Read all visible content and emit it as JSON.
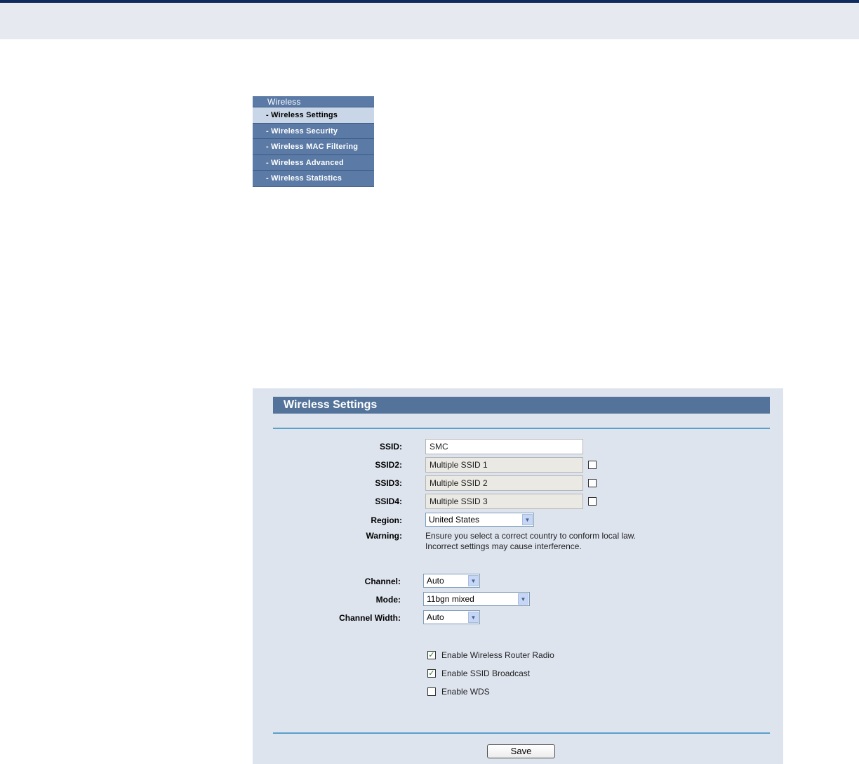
{
  "menu": {
    "header": "Wireless",
    "items": [
      {
        "label": "- Wireless Settings",
        "active": true
      },
      {
        "label": "- Wireless Security",
        "active": false
      },
      {
        "label": "- Wireless MAC Filtering",
        "active": false
      },
      {
        "label": "- Wireless Advanced",
        "active": false
      },
      {
        "label": "- Wireless Statistics",
        "active": false
      }
    ]
  },
  "panel": {
    "title": "Wireless Settings",
    "ssid": {
      "label": "SSID:",
      "value": "SMC"
    },
    "ssid2": {
      "label": "SSID2:",
      "value": "Multiple SSID 1",
      "checked": false
    },
    "ssid3": {
      "label": "SSID3:",
      "value": "Multiple SSID 2",
      "checked": false
    },
    "ssid4": {
      "label": "SSID4:",
      "value": "Multiple SSID 3",
      "checked": false
    },
    "region": {
      "label": "Region:",
      "value": "United States"
    },
    "warning": {
      "label": "Warning:",
      "line1": "Ensure you select a correct country to conform local law.",
      "line2": "Incorrect settings may cause interference."
    },
    "channel": {
      "label": "Channel:",
      "value": "Auto"
    },
    "mode": {
      "label": "Mode:",
      "value": "11bgn mixed"
    },
    "channel_width": {
      "label": "Channel Width:",
      "value": "Auto"
    },
    "options": {
      "radio": {
        "label": "Enable Wireless Router Radio",
        "checked": true
      },
      "broadcast": {
        "label": "Enable SSID Broadcast",
        "checked": true
      },
      "wds": {
        "label": "Enable WDS",
        "checked": false
      }
    },
    "save_label": "Save"
  },
  "colors": {
    "menu_bg": "#5b7ba6",
    "menu_active": "#c9d6e8",
    "panel_bg": "#dde4ee",
    "title_bg": "#53739a",
    "rule": "#5aa0cc"
  }
}
